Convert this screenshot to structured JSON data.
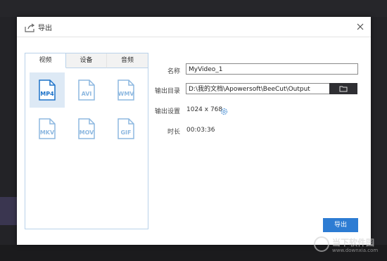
{
  "dialog": {
    "title": "导出",
    "close_icon": "close-icon",
    "title_icon": "export-icon"
  },
  "tabs": [
    {
      "label": "视频",
      "active": true
    },
    {
      "label": "设备",
      "active": false
    },
    {
      "label": "音频",
      "active": false
    }
  ],
  "formats": [
    {
      "label": "MP4",
      "selected": true
    },
    {
      "label": "AVI",
      "selected": false
    },
    {
      "label": "WMV",
      "selected": false
    },
    {
      "label": "MKV",
      "selected": false
    },
    {
      "label": "MOV",
      "selected": false
    },
    {
      "label": "GIF",
      "selected": false
    }
  ],
  "form": {
    "name_label": "名称",
    "name_value": "MyVideo_1",
    "dir_label": "输出目录",
    "dir_value": "D:\\我的文档\\Apowersoft\\BeeCut\\Output",
    "settings_label": "输出设置",
    "settings_value": "1024 x 768",
    "duration_label": "时长",
    "duration_value": "00:03:36"
  },
  "export_button": "导出",
  "watermark": {
    "text": "当下软件园",
    "url": "www.downxia.com"
  },
  "colors": {
    "accent": "#2d7cd3",
    "selected_bg": "#dde9f5",
    "panel_border": "#b9d2ea"
  }
}
